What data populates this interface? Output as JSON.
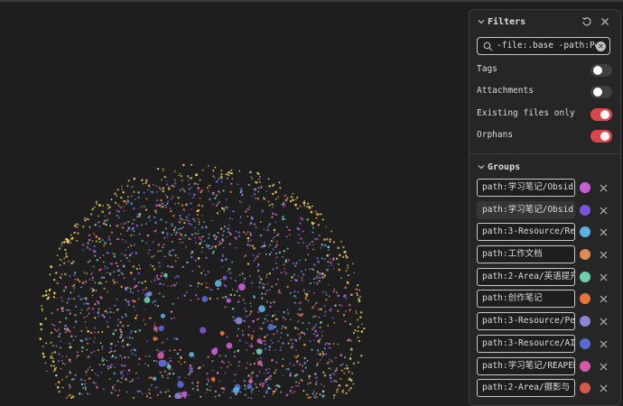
{
  "filters": {
    "title": "Filters",
    "search_value": "-file:.base -path:Pe",
    "options": [
      {
        "label": "Tags",
        "enabled": false
      },
      {
        "label": "Attachments",
        "enabled": false
      },
      {
        "label": "Existing files only",
        "enabled": true
      },
      {
        "label": "Orphans",
        "enabled": true
      }
    ]
  },
  "groups": {
    "title": "Groups",
    "items": [
      {
        "query": "path:学习笔记/Obsidian",
        "color": "#c95fd6",
        "active": false
      },
      {
        "query": "path:学习笔记/Obsidian",
        "color": "#7a55d6",
        "active": true
      },
      {
        "query": "path:3-Resource/Re",
        "color": "#5ab3e6",
        "active": false
      },
      {
        "query": "path:工作文档",
        "color": "#e08a52",
        "active": false
      },
      {
        "query": "path:2-Area/英语提升",
        "color": "#6fcdb0",
        "active": false
      },
      {
        "query": "path:创作笔记",
        "color": "#e8763c",
        "active": false
      },
      {
        "query": "path:3-Resource/Pe",
        "color": "#8a86d6",
        "active": false
      },
      {
        "query": "path:3-Resource/AI",
        "color": "#5a6ad0",
        "active": false
      },
      {
        "query": "path:学习笔记/REAPER",
        "color": "#d65aa8",
        "active": false
      },
      {
        "query": "path:2-Area/摄影与",
        "color": "#d65a4a",
        "active": false
      }
    ]
  },
  "graph_colors": [
    "#e8d36a",
    "#f0a24b",
    "#5ab3e6",
    "#6fcdb0",
    "#c95fd6",
    "#e8763c",
    "#8a86d6",
    "#d65aa8",
    "#7a55d6",
    "#5a6ad0"
  ]
}
